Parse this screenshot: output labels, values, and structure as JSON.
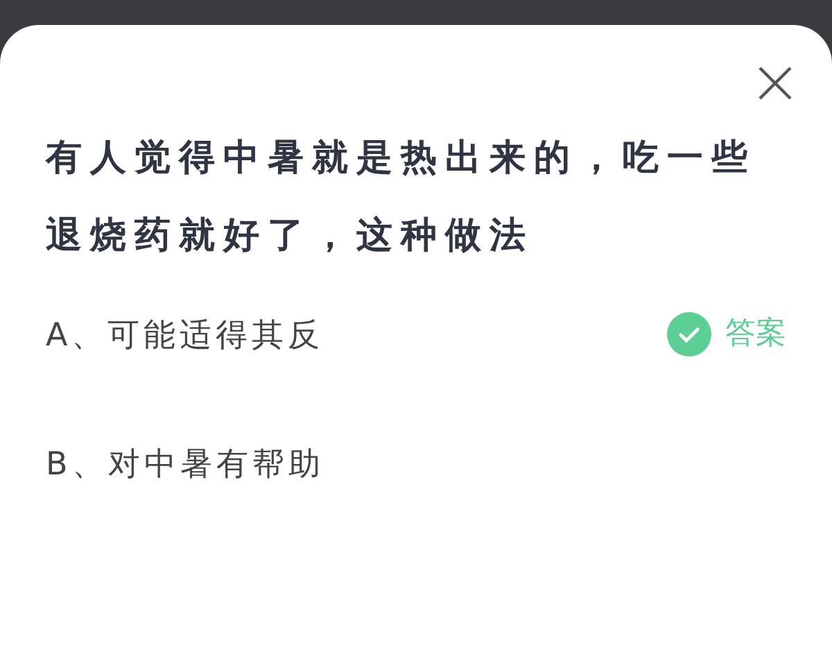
{
  "question": "有人觉得中暑就是热出来的，吃一些退烧药就好了，这种做法",
  "options": [
    {
      "label": "A、可能适得其反",
      "correct": true
    },
    {
      "label": "B、对中暑有帮助",
      "correct": false
    }
  ],
  "answer_badge": "答案"
}
